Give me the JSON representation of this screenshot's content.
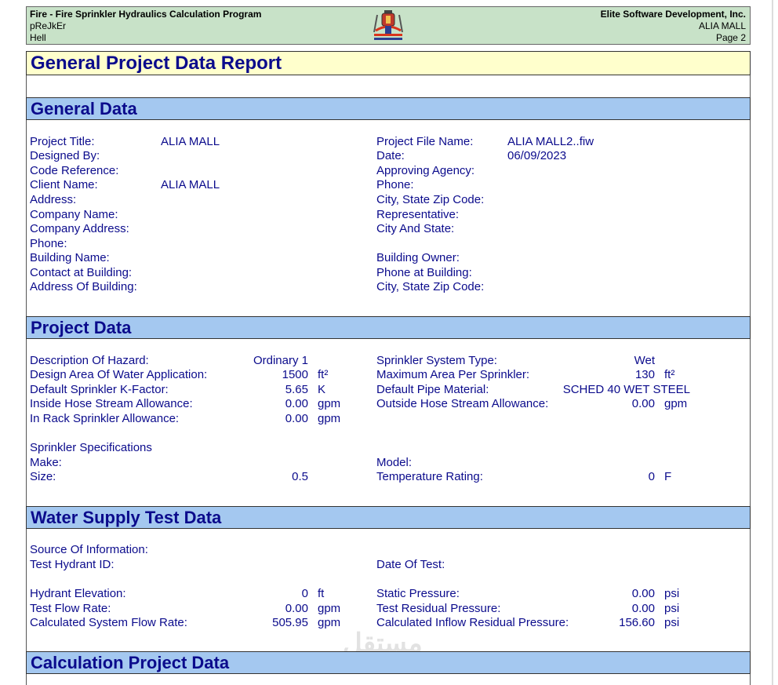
{
  "header": {
    "program": "Fire - Fire Sprinkler Hydraulics Calculation Program",
    "line2": "pReJkEr",
    "line3": "Hell",
    "company": "Elite Software Development, Inc.",
    "project": "ALIA MALL",
    "page": "Page 2",
    "logo_icon": "sprinkler-logo-icon"
  },
  "report_title": "General Project Data Report",
  "sections": {
    "general": "General Data",
    "project": "Project Data",
    "water": "Water Supply Test Data",
    "calc": "Calculation Project Data"
  },
  "general": {
    "left": [
      {
        "label": "Project Title:",
        "value": "ALIA MALL"
      },
      {
        "label": "Designed By:",
        "value": ""
      },
      {
        "label": "Code Reference:",
        "value": ""
      },
      {
        "label": "Client Name:",
        "value": "ALIA MALL"
      },
      {
        "label": "Address:",
        "value": ""
      },
      {
        "label": "Company Name:",
        "value": ""
      },
      {
        "label": "Company Address:",
        "value": ""
      },
      {
        "label": "Phone:",
        "value": ""
      },
      {
        "label": "Building Name:",
        "value": ""
      },
      {
        "label": "Contact at Building:",
        "value": ""
      },
      {
        "label": "Address Of Building:",
        "value": ""
      }
    ],
    "right": [
      {
        "label": "Project File Name:",
        "value": "ALIA MALL2..fiw"
      },
      {
        "label": "Date:",
        "value": "06/09/2023"
      },
      {
        "label": "Approving Agency:",
        "value": ""
      },
      {
        "label": "Phone:",
        "value": ""
      },
      {
        "label": "City, State Zip Code:",
        "value": ""
      },
      {
        "label": "Representative:",
        "value": ""
      },
      {
        "label": "City And State:",
        "value": ""
      },
      {
        "label": "",
        "value": ""
      },
      {
        "label": "Building Owner:",
        "value": ""
      },
      {
        "label": "Phone at Building:",
        "value": ""
      },
      {
        "label": "City, State Zip Code:",
        "value": ""
      }
    ]
  },
  "project": {
    "hazard_label": "Description Of Hazard:",
    "hazard_value": "Ordinary 1",
    "area_label": "Design Area Of Water Application:",
    "area_value": "1500",
    "area_unit": "ft²",
    "kfactor_label": "Default Sprinkler K-Factor:",
    "kfactor_value": "5.65",
    "kfactor_unit": "K",
    "inside_label": "Inside Hose Stream Allowance:",
    "inside_value": "0.00",
    "inside_unit": "gpm",
    "inrack_label": "In Rack Sprinkler Allowance:",
    "inrack_value": "0.00",
    "inrack_unit": "gpm",
    "systype_label": "Sprinkler System Type:",
    "systype_value": "Wet",
    "maxarea_label": "Maximum Area Per Sprinkler:",
    "maxarea_value": "130",
    "maxarea_unit": "ft²",
    "pipe_label": "Default Pipe Material:",
    "pipe_value": "SCHED 40 WET STEEL",
    "outside_label": "Outside Hose Stream Allowance:",
    "outside_value": "0.00",
    "outside_unit": "gpm",
    "spec_label": "Sprinkler Specifications",
    "make_label": "Make:",
    "model_label": "Model:",
    "size_label": "Size:",
    "size_value": "0.5",
    "temp_label": "Temperature Rating:",
    "temp_value": "0",
    "temp_unit": "F"
  },
  "water": {
    "source_label": "Source Of Information:",
    "hydrant_label": "Test Hydrant ID:",
    "date_label": "Date Of Test:",
    "elev_label": "Hydrant Elevation:",
    "elev_value": "0",
    "elev_unit": "ft",
    "flow_label": "Test Flow Rate:",
    "flow_value": "0.00",
    "flow_unit": "gpm",
    "calcflow_label": "Calculated System Flow Rate:",
    "calcflow_value": "505.95",
    "calcflow_unit": "gpm",
    "static_label": "Static Pressure:",
    "static_value": "0.00",
    "static_unit": "psi",
    "resid_label": "Test Residual Pressure:",
    "resid_value": "0.00",
    "resid_unit": "psi",
    "inflow_label": "Calculated Inflow Residual Pressure:",
    "inflow_value": "156.60",
    "inflow_unit": "psi"
  },
  "watermark": "مستقل"
}
